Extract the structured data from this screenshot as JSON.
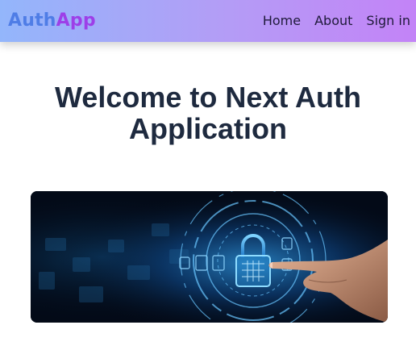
{
  "navbar": {
    "logo_part1": "Auth",
    "logo_part2": "App",
    "links": [
      "Home",
      "About",
      "Sign in"
    ]
  },
  "main": {
    "title_line1": "Welcome to Next Auth",
    "title_line2": "Application"
  },
  "colors": {
    "navbar_gradient_start": "#93b6fb",
    "navbar_gradient_end": "#c383f7",
    "logo_blue": "#4f7de6",
    "logo_purple": "#9d3fe8",
    "heading": "#1e2a3f"
  }
}
